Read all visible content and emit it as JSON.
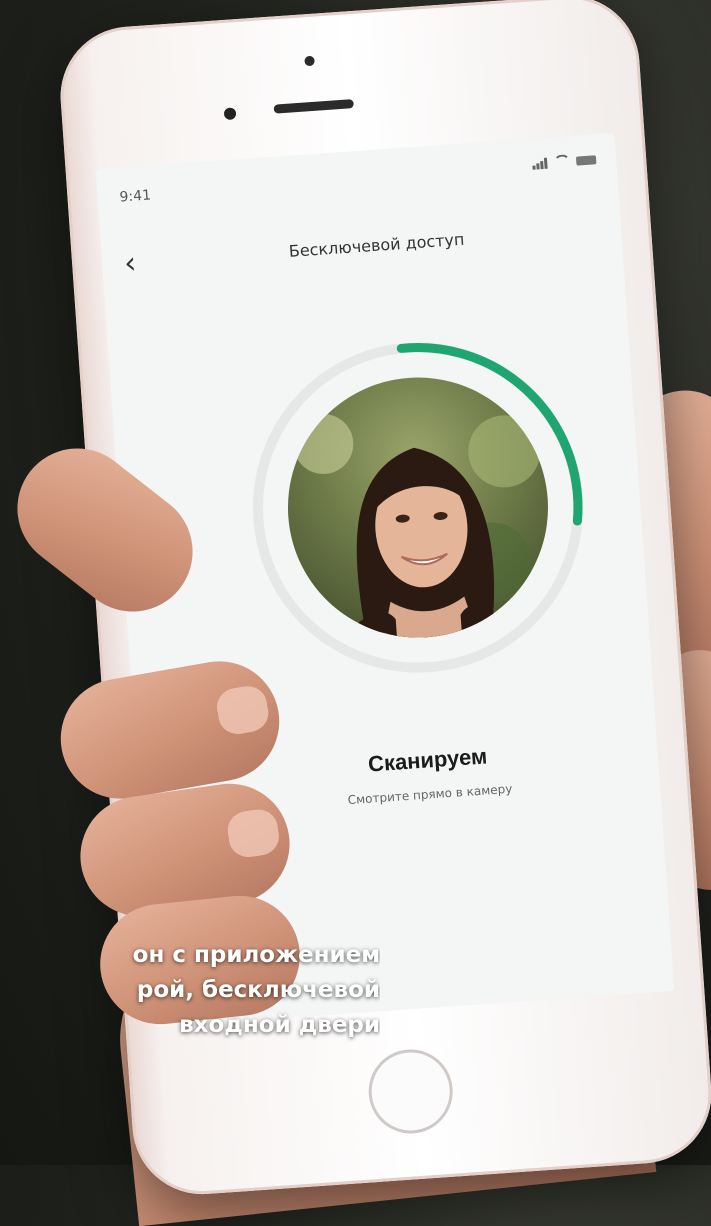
{
  "status_bar": {
    "time": "9:41"
  },
  "header": {
    "back_icon": "chevron-left-icon",
    "title": "Бесключевой доступ"
  },
  "scan": {
    "title": "Сканируем",
    "subtitle": "Смотрите прямо в камеру",
    "progress": 0.28,
    "progress_color": "#1fa56f"
  },
  "caption": {
    "lines": [
      "он с приложением",
      "рой, бесключевой",
      "входной двери"
    ]
  }
}
